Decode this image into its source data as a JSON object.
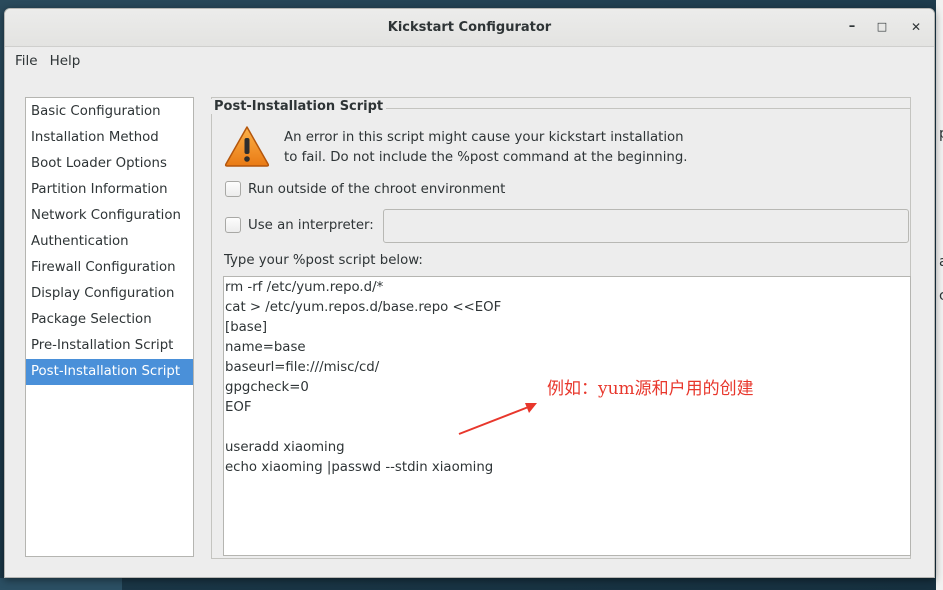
{
  "window": {
    "title": "Kickstart Configurator",
    "controls": {
      "minimize": "–",
      "maximize": "□",
      "close": "✕"
    }
  },
  "menubar": {
    "items": [
      "File",
      "Help"
    ]
  },
  "sidebar": {
    "items": [
      {
        "label": "Basic Configuration",
        "active": false
      },
      {
        "label": "Installation Method",
        "active": false
      },
      {
        "label": "Boot Loader Options",
        "active": false
      },
      {
        "label": "Partition Information",
        "active": false
      },
      {
        "label": "Network Configuration",
        "active": false
      },
      {
        "label": "Authentication",
        "active": false
      },
      {
        "label": "Firewall Configuration",
        "active": false
      },
      {
        "label": "Display Configuration",
        "active": false
      },
      {
        "label": "Package Selection",
        "active": false
      },
      {
        "label": "Pre-Installation Script",
        "active": false
      },
      {
        "label": "Post-Installation Script",
        "active": true
      }
    ]
  },
  "panel": {
    "title": "Post-Installation Script",
    "warning_icon": "warning-triangle-icon",
    "warning_line1": "An error in this script might cause your kickstart installation",
    "warning_line2": "to fail. Do not include the %post command at the beginning.",
    "chroot_label": "Run outside of the chroot environment",
    "chroot_checked": false,
    "interpreter_label": "Use an interpreter:",
    "interpreter_checked": false,
    "interpreter_value": "",
    "script_label": "Type your %post script below:",
    "script_lines": [
      "rm -rf /etc/yum.repo.d/*",
      "cat > /etc/yum.repos.d/base.repo <<EOF",
      "[base]",
      "name=base",
      "baseurl=file:///misc/cd/",
      "gpgcheck=0",
      "EOF",
      "",
      "useradd xiaoming",
      "echo xiaoming |passwd --stdin xiaoming"
    ]
  },
  "annotation": {
    "text": "例如：yum源和户用的创建",
    "color": "#e8372c"
  },
  "colors": {
    "selection": "#4a90d9",
    "window_bg": "#ededed"
  }
}
